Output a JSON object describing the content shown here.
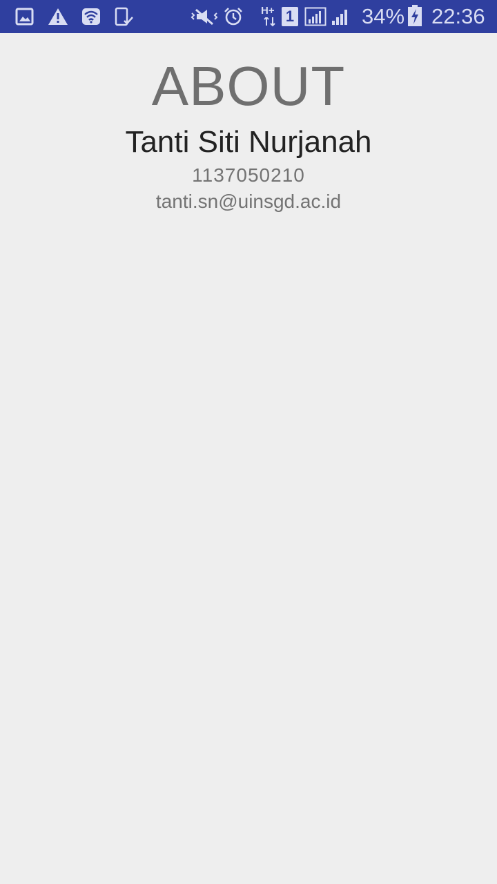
{
  "status_bar": {
    "icons": [
      "gallery-icon",
      "warning-icon",
      "wifi-hotspot-icon",
      "device-check-icon",
      "vibrate-mute-icon",
      "alarm-icon",
      "hplus-data-icon",
      "sim1-icon",
      "signal-icon",
      "signal-2-icon",
      "battery-charging-icon"
    ],
    "battery_percent": "34%",
    "time": "22:36",
    "network_label": "H+",
    "sim_label": "1",
    "background_color": "#2f3f9f"
  },
  "about": {
    "title": "ABOUT",
    "name": "Tanti Siti Nurjanah",
    "nim": "1137050210",
    "email": "tanti.sn@uinsgd.ac.id"
  },
  "colors": {
    "background": "#eeeeee",
    "title": "#6f6f6f",
    "name": "#222222",
    "detail": "#737373"
  }
}
